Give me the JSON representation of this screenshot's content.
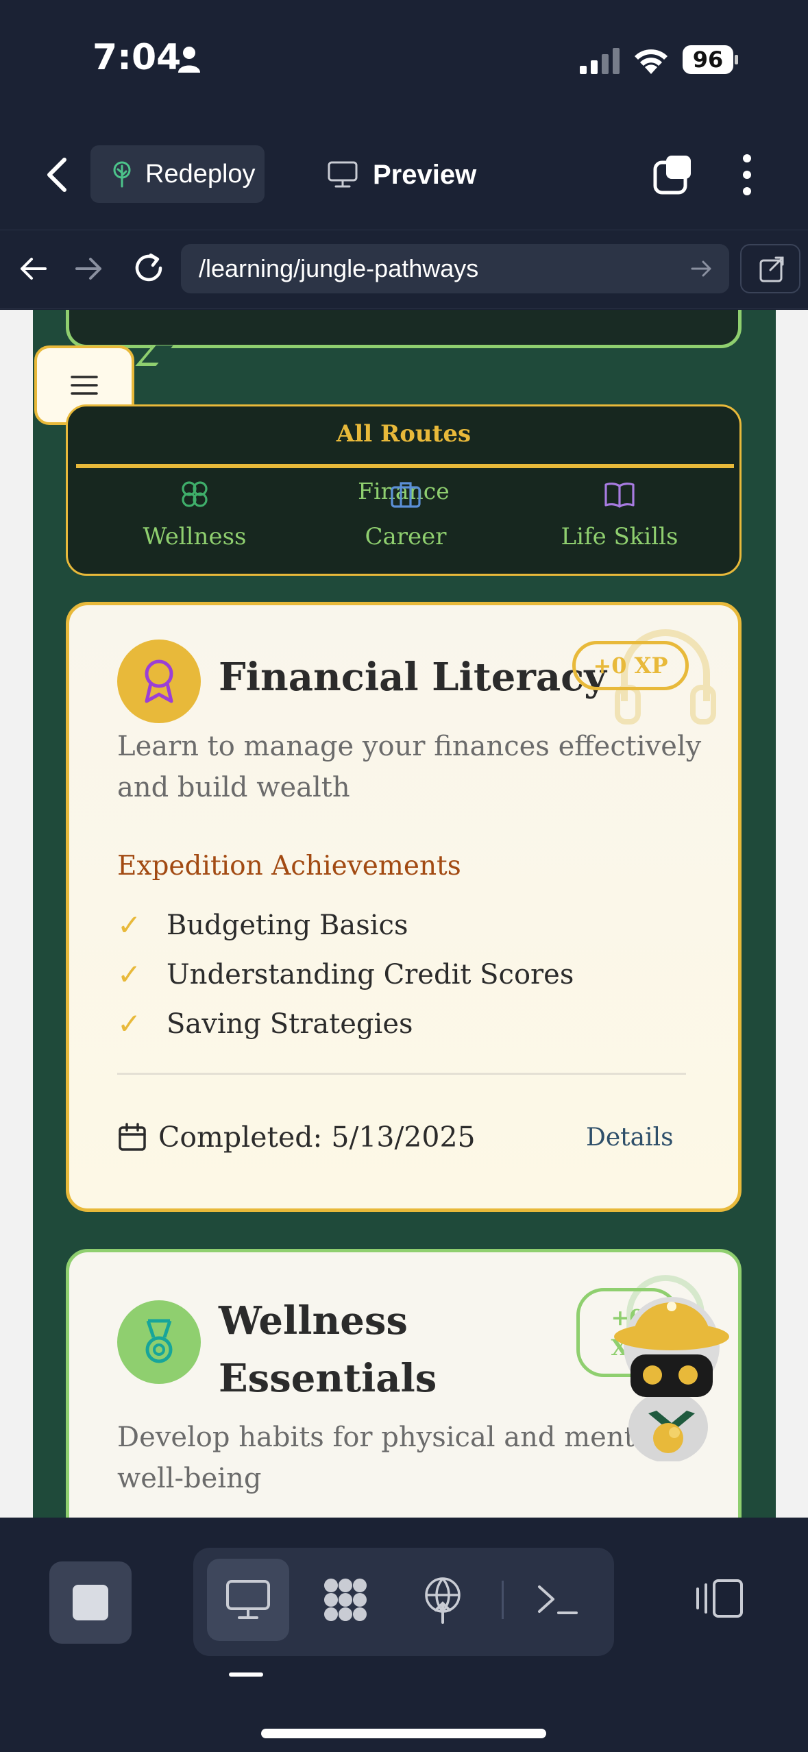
{
  "status_bar": {
    "time": "7:04",
    "battery": "96"
  },
  "app_bar": {
    "redeploy_label": "Redeploy",
    "preview_label": "Preview"
  },
  "browser": {
    "url": "/learning/jungle-pathways"
  },
  "routes": {
    "title": "All Routes",
    "finance_label": "Finance",
    "items": [
      {
        "label": "Wellness",
        "icon": "clover-icon",
        "color": "#3fae6a"
      },
      {
        "label": "Career",
        "icon": "briefcase-icon",
        "color": "#5b8fd6"
      },
      {
        "label": "Life Skills",
        "icon": "book-icon",
        "color": "#a77be0"
      }
    ]
  },
  "cards": [
    {
      "title": "Financial Literacy",
      "xp": "+0 XP",
      "description": "Learn to manage your finances effectively and build wealth",
      "achievements_title": "Expedition Achievements",
      "achievements": [
        "Budgeting Basics",
        "Understanding Credit Scores",
        "Saving Strategies"
      ],
      "completed": "Completed: 5/13/2025",
      "details_label": "Details",
      "icon": "award-ribbon-icon",
      "accent": "#e8b93a"
    },
    {
      "title_line1": "Wellness",
      "title_line2": "Essentials",
      "xp_line1": "+0",
      "xp_line2": "XP",
      "description": "Develop habits for physical and mental well-being",
      "icon": "medal-icon",
      "accent": "#8fcf6f"
    }
  ],
  "colors": {
    "jungle_bg": "#1f4a3a",
    "gold": "#e8b93a",
    "leaf": "#8fcf6f",
    "chrome": "#1b2234"
  }
}
